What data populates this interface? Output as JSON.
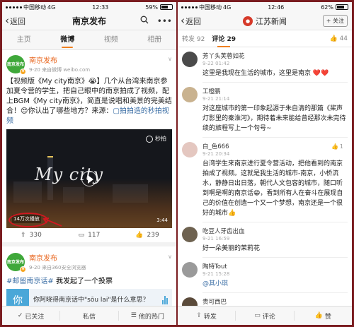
{
  "left": {
    "status": {
      "carrier": "中国移动",
      "network": "4G",
      "time": "12:33",
      "battery": "59%",
      "battery_level": 0.59
    },
    "nav": {
      "back_label": "返回",
      "title": "南京发布",
      "search_icon": "search-icon",
      "more_icon": "more-icon"
    },
    "tabs": [
      {
        "label": "主页",
        "active": false
      },
      {
        "label": "微博",
        "active": true
      },
      {
        "label": "视频",
        "active": false
      },
      {
        "label": "相册",
        "active": false
      }
    ],
    "post1": {
      "user": "南京发布",
      "avatar_text": "南京发布",
      "meta": "9-20 来自微博 weibo.com",
      "text": "【视频版《My city南京》😭】几个从台湾来南京参加夏令营的学生，把自己眼中的南京拍成了视频，配上BGM《My city南京》，简直是说唱和美景的完美结合！😍你认出了哪些地方？来源：",
      "link": "▢拍拍造的秒拍视频",
      "video": {
        "script_title": "My city",
        "brand": "秒拍",
        "plays": "14万次播放",
        "duration": "3:44"
      },
      "actions": [
        {
          "icon": "repost-icon",
          "count": "330"
        },
        {
          "icon": "comment-icon",
          "count": "117"
        },
        {
          "icon": "like-icon",
          "count": "239"
        }
      ]
    },
    "post2": {
      "user": "南京发布",
      "meta": "9-20 来自360安全浏览器",
      "tag": "#邮留南京话#",
      "tag_tail": " 我发起了一个投票",
      "vote_tile": "你",
      "vote_question": "你阿晓得南京话中\"sōu lai\"是什么意思？"
    },
    "bottom": [
      {
        "label": "已关注",
        "icon": "check-icon"
      },
      {
        "label": "私信",
        "icon": ""
      },
      {
        "label": "他的热门",
        "icon": "menu-icon"
      }
    ]
  },
  "right": {
    "status": {
      "carrier": "中国移动",
      "network": "4G",
      "time": "12:46",
      "battery": "62%",
      "battery_level": 0.62
    },
    "nav": {
      "back_label": "返回",
      "title": "江苏新闻",
      "follow": "+ 关注"
    },
    "tabs": {
      "repost": "转发 92",
      "comment": "评论 29",
      "likes": "44"
    },
    "comments": [
      {
        "name": "芳丫头芙蓉如花",
        "time": "9-22 01:42",
        "text": "这里是我现在生活的城市，这里是南京",
        "hearts": "❤️❤️",
        "likes": ""
      },
      {
        "name": "工橙鹏",
        "time": "9-21 21:14",
        "text": "对这座城市的第一印象起源于朱自清的那篇《桨声灯影里的秦淮河》，期待着未来能给曾经那次未完待续的旅程写上一个句号~",
        "likes": ""
      },
      {
        "name": "白_色666",
        "time": "9-21 20:34",
        "text": "台湾学生来南京进行夏令营活动，把他看到的南京拍成了视频。这就是我生活的城市-南京，小桥流水，静静日出日落，朝代人文包容的城市，随口听到啊是啊的南京话😁，看到所有人在奋斗在展现自己的价值在创造一个又一个梦想，南京还是一个很好的城市👍",
        "likes": "1"
      },
      {
        "name": "吃豆人牙齿出血",
        "time": "9-21 16:59",
        "text": "好一朵美丽的茉莉花",
        "likes": ""
      },
      {
        "name": "陶特Tout",
        "time": "9-21 15:28",
        "text": "@其小琪",
        "likes": ""
      },
      {
        "name": "贵可西巴",
        "time": "",
        "text": "",
        "likes": ""
      }
    ],
    "bottom": [
      {
        "label": "转发",
        "icon": "repost-icon"
      },
      {
        "label": "评论",
        "icon": "comment-icon"
      },
      {
        "label": "赞",
        "icon": "like-icon"
      }
    ]
  }
}
